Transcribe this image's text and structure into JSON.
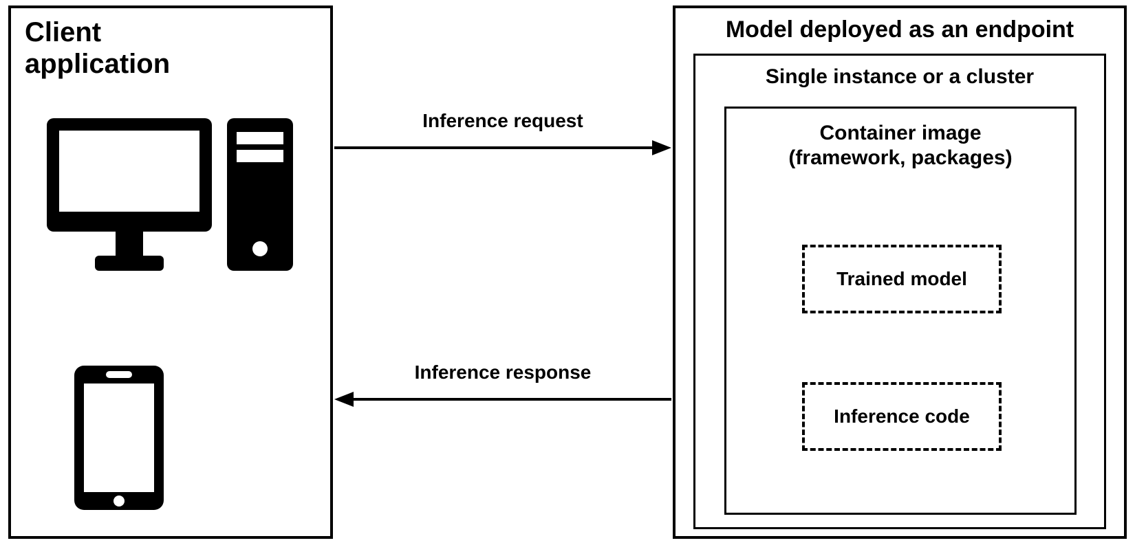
{
  "client": {
    "title": "Client application"
  },
  "endpoint": {
    "title": "Model deployed as an endpoint",
    "cluster_title": "Single instance or a cluster",
    "container_title_line1": "Container image",
    "container_title_line2": "(framework, packages)",
    "trained_model": "Trained model",
    "inference_code": "Inference code"
  },
  "arrows": {
    "request": "Inference request",
    "response": "Inference response"
  }
}
